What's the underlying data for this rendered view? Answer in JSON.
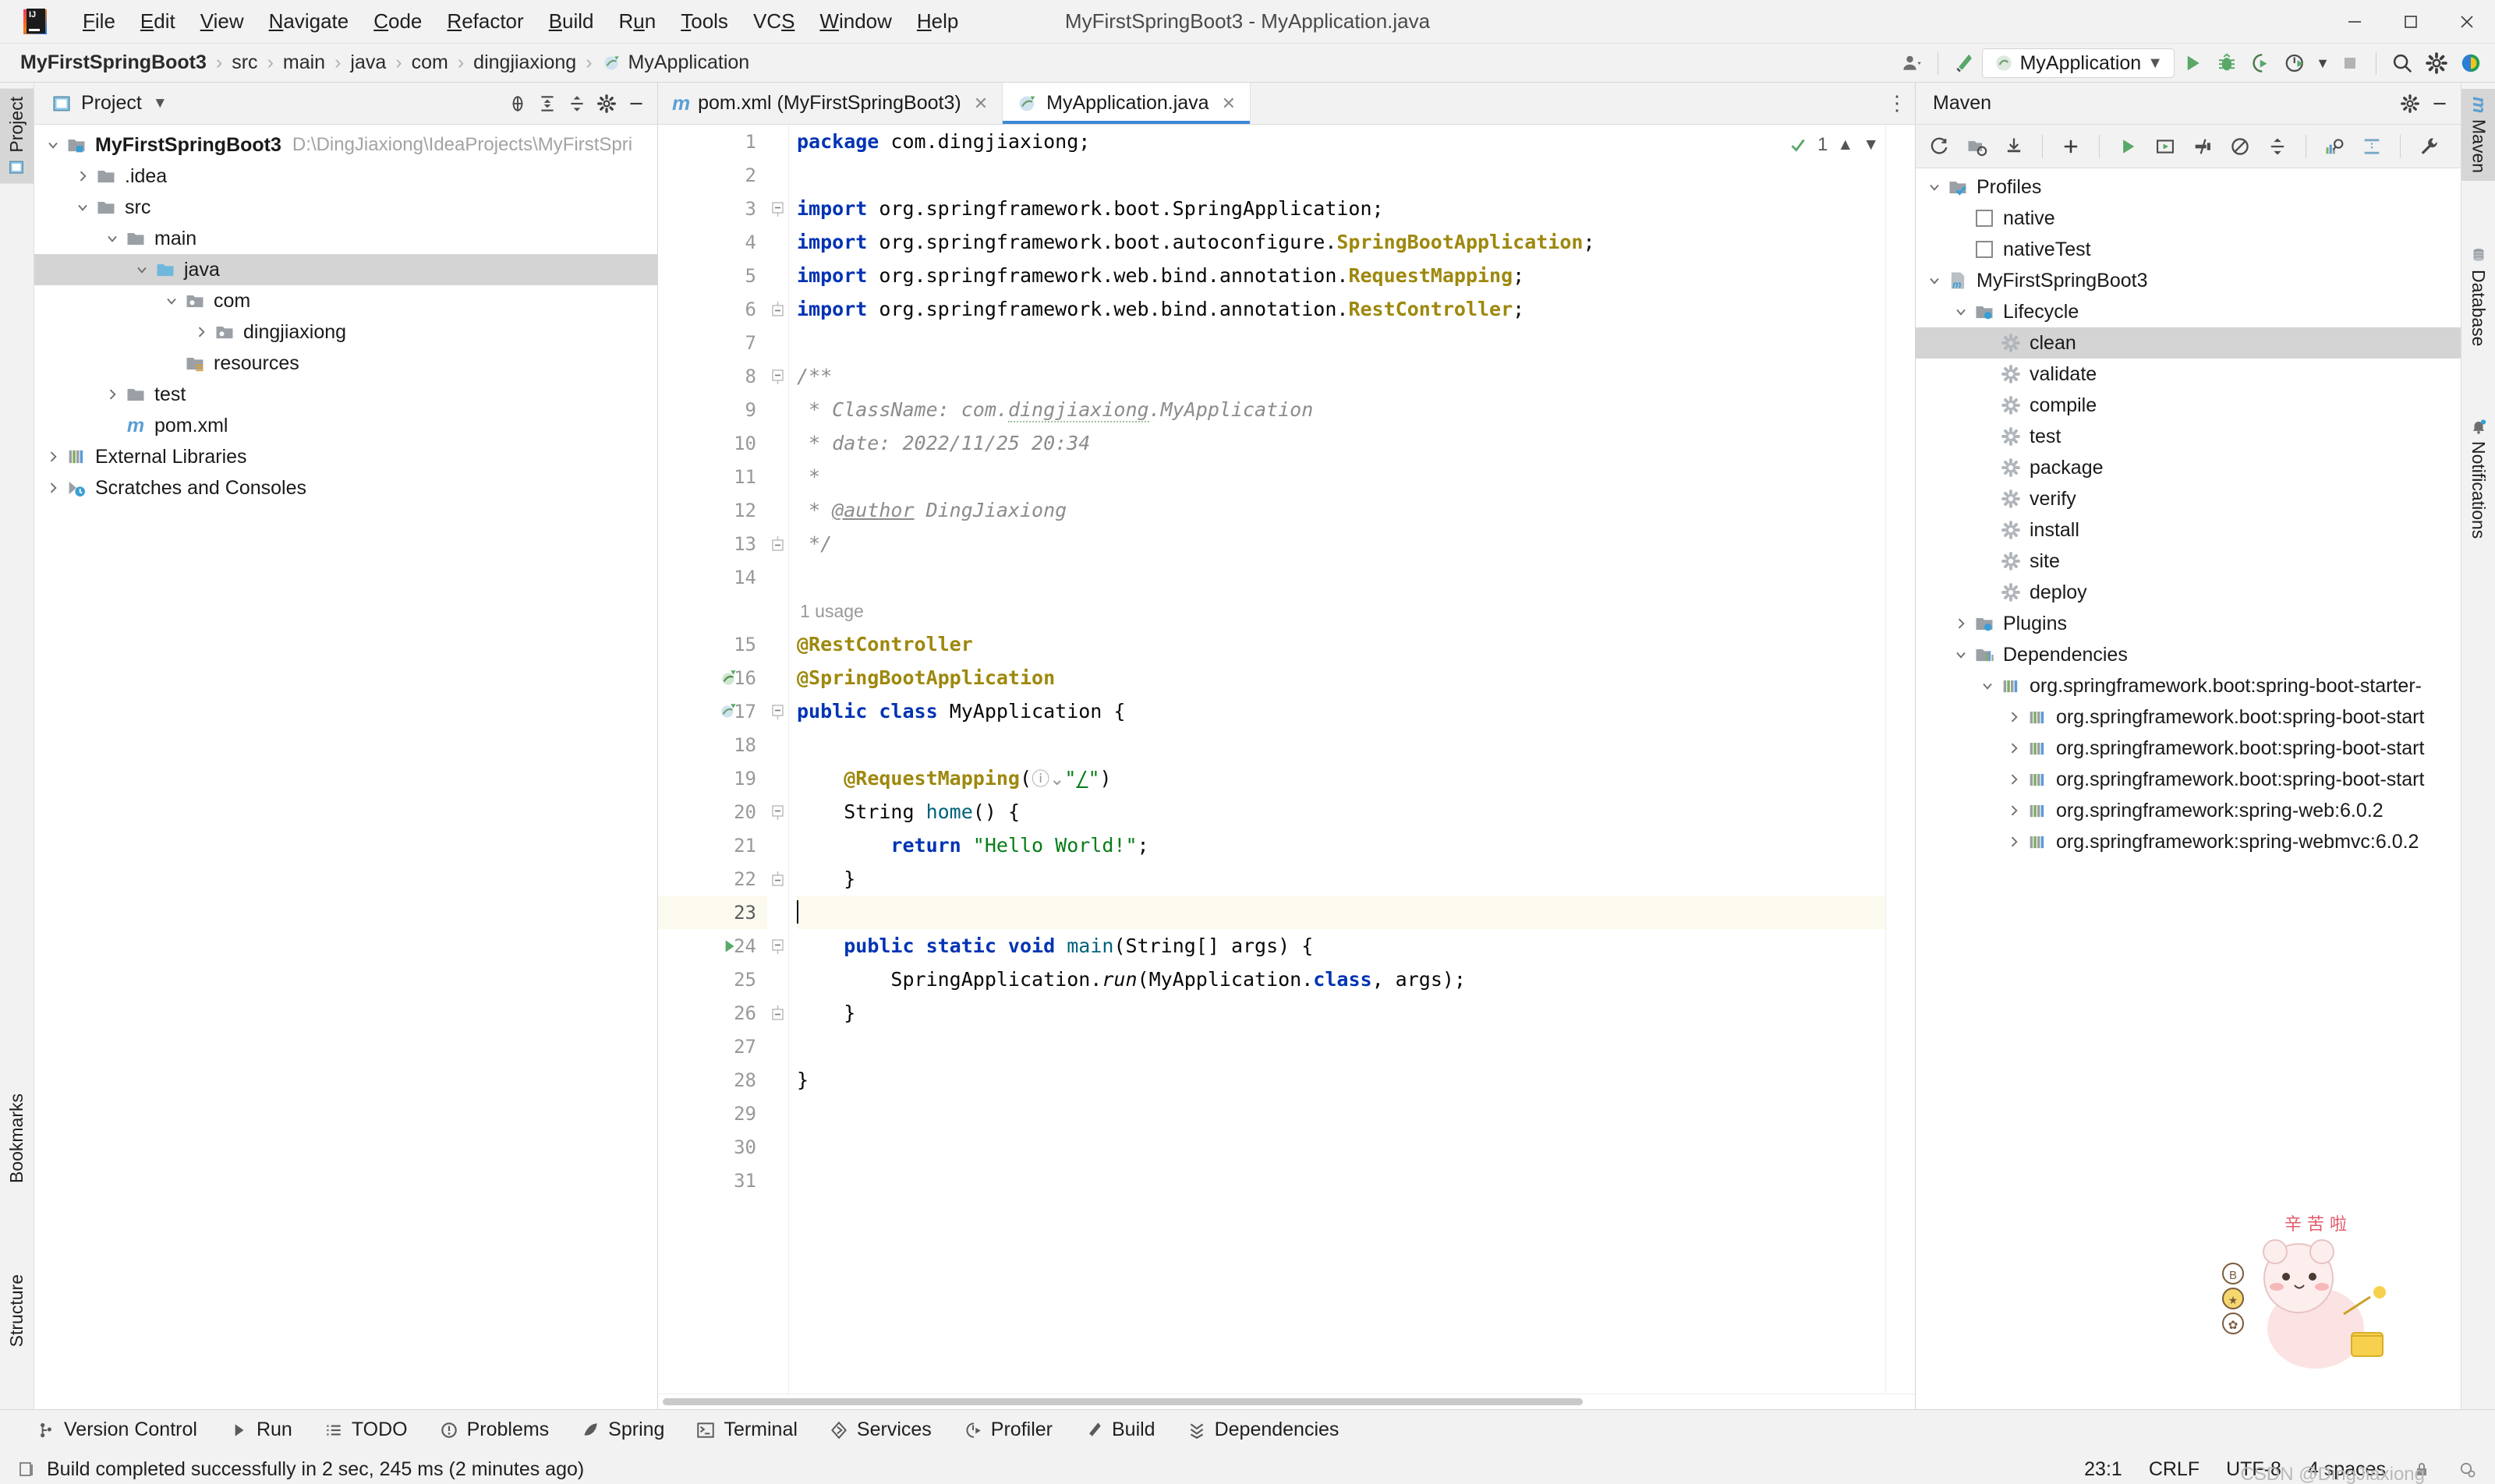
{
  "window": {
    "title": "MyFirstSpringBoot3 - MyApplication.java",
    "minimize_label": "—",
    "maximize_label": "❐",
    "close_label": "✕"
  },
  "menubar": {
    "items": [
      {
        "label": "File",
        "mnemonic": "F"
      },
      {
        "label": "Edit",
        "mnemonic": "E"
      },
      {
        "label": "View",
        "mnemonic": "V"
      },
      {
        "label": "Navigate",
        "mnemonic": "N"
      },
      {
        "label": "Code",
        "mnemonic": "C"
      },
      {
        "label": "Refactor",
        "mnemonic": "R"
      },
      {
        "label": "Build",
        "mnemonic": "B"
      },
      {
        "label": "Run",
        "mnemonic": "u"
      },
      {
        "label": "Tools",
        "mnemonic": "T"
      },
      {
        "label": "VCS",
        "mnemonic": "S"
      },
      {
        "label": "Window",
        "mnemonic": "W"
      },
      {
        "label": "Help",
        "mnemonic": "H"
      }
    ]
  },
  "navbar": {
    "crumbs": [
      "MyFirstSpringBoot3",
      "src",
      "main",
      "java",
      "com",
      "dingjiaxiong",
      "MyApplication"
    ],
    "separator": "›",
    "run_config": "MyApplication",
    "icons": [
      "profile-icon",
      "build-hammer-icon",
      "run-icon",
      "debug-icon",
      "run-coverage-icon",
      "profiler-icon",
      "stop-icon",
      "search-icon",
      "settings-icon",
      "ide-assistant-icon"
    ]
  },
  "left_toolbar": {
    "tabs": [
      {
        "label": "Project",
        "selected": true
      },
      {
        "label": "Bookmarks",
        "selected": false
      },
      {
        "label": "Structure",
        "selected": false
      }
    ]
  },
  "right_toolbar": {
    "tabs": [
      {
        "label": "Maven",
        "selected": true
      },
      {
        "label": "Database",
        "selected": false
      },
      {
        "label": "Notifications",
        "selected": false
      }
    ]
  },
  "project_panel": {
    "title": "Project",
    "toolbar_icons": [
      "locate-icon",
      "expand-all-icon",
      "collapse-all-icon",
      "settings-icon",
      "hide-icon"
    ],
    "tree": [
      {
        "depth": 0,
        "arrow": "down",
        "icon": "module-icon",
        "label": "MyFirstSpringBoot3",
        "bold": true,
        "sub": "D:\\DingJiaxiong\\IdeaProjects\\MyFirstSpri",
        "selected": false
      },
      {
        "depth": 1,
        "arrow": "right",
        "icon": "folder-icon",
        "label": ".idea",
        "bold": false,
        "sub": "",
        "selected": false
      },
      {
        "depth": 1,
        "arrow": "down",
        "icon": "folder-icon",
        "label": "src",
        "bold": false,
        "sub": "",
        "selected": false
      },
      {
        "depth": 2,
        "arrow": "down",
        "icon": "folder-icon",
        "label": "main",
        "bold": false,
        "sub": "",
        "selected": false
      },
      {
        "depth": 3,
        "arrow": "down",
        "icon": "source-folder-icon",
        "label": "java",
        "bold": false,
        "sub": "",
        "selected": true
      },
      {
        "depth": 4,
        "arrow": "down",
        "icon": "package-icon",
        "label": "com",
        "bold": false,
        "sub": "",
        "selected": false
      },
      {
        "depth": 5,
        "arrow": "right",
        "icon": "package-icon",
        "label": "dingjiaxiong",
        "bold": false,
        "sub": "",
        "selected": false
      },
      {
        "depth": 4,
        "arrow": "none",
        "icon": "resources-folder-icon",
        "label": "resources",
        "bold": false,
        "sub": "",
        "selected": false
      },
      {
        "depth": 2,
        "arrow": "right",
        "icon": "folder-icon",
        "label": "test",
        "bold": false,
        "sub": "",
        "selected": false
      },
      {
        "depth": 2,
        "arrow": "none",
        "icon": "maven-file-icon",
        "label": "pom.xml",
        "bold": false,
        "sub": "",
        "selected": false
      },
      {
        "depth": 0,
        "arrow": "right",
        "icon": "library-icon",
        "label": "External Libraries",
        "bold": false,
        "sub": "",
        "selected": false
      },
      {
        "depth": 0,
        "arrow": "right",
        "icon": "scratches-icon",
        "label": "Scratches and Consoles",
        "bold": false,
        "sub": "",
        "selected": false
      }
    ]
  },
  "editor": {
    "tabs": [
      {
        "label": "pom.xml (MyFirstSpringBoot3)",
        "icon": "maven-file-icon",
        "active": false,
        "closable": true
      },
      {
        "label": "MyApplication.java",
        "icon": "spring-class-icon",
        "active": true,
        "closable": true
      }
    ],
    "inspection_count": "1",
    "inspection_icons": [
      "inspection-ok-icon",
      "prev-problem-icon",
      "next-problem-icon"
    ],
    "tab_overflow_icon": "more-vertical-icon",
    "total_lines": 31,
    "current_line": 23,
    "lines": [
      {
        "n": 1,
        "html": "<span class=\"kw\">package</span> <span class=\"plain\">com.dingjiaxiong;</span>"
      },
      {
        "n": 2,
        "html": ""
      },
      {
        "n": 3,
        "html": "<span class=\"kw\">import</span> <span class=\"plain\">org.springframework.boot.SpringApplication;</span>"
      },
      {
        "n": 4,
        "html": "<span class=\"kw\">import</span> <span class=\"plain\">org.springframework.boot.autoconfigure.</span><span class=\"ann\">SpringBootApplication</span><span class=\"plain\">;</span>"
      },
      {
        "n": 5,
        "html": "<span class=\"kw\">import</span> <span class=\"plain\">org.springframework.web.bind.annotation.</span><span class=\"ann\">RequestMapping</span><span class=\"plain\">;</span>"
      },
      {
        "n": 6,
        "html": "<span class=\"kw\">import</span> <span class=\"plain\">org.springframework.web.bind.annotation.</span><span class=\"ann\">RestController</span><span class=\"plain\">;</span>"
      },
      {
        "n": 7,
        "html": ""
      },
      {
        "n": 8,
        "html": "<span class=\"cmt\">/**</span>"
      },
      {
        "n": 9,
        "html": "<span class=\"cmt\"> * ClassName: com.<span class=\"squig\">dingjiaxiong</span>.MyApplication</span>"
      },
      {
        "n": 10,
        "html": "<span class=\"cmt\"> * date: 2022/11/25 20:34</span>"
      },
      {
        "n": 11,
        "html": "<span class=\"cmt\"> *</span>"
      },
      {
        "n": 12,
        "html": "<span class=\"cmt\"> * <span class=\"ulink\">@author</span> DingJiaxiong</span>"
      },
      {
        "n": 13,
        "html": "<span class=\"cmt\"> */</span>"
      },
      {
        "n": 14,
        "html": ""
      },
      {
        "n": 15,
        "html": "<span class=\"ann\">@RestController</span>",
        "above": "1 usage"
      },
      {
        "n": 16,
        "html": "<span class=\"ann\">@SpringBootApplication</span>"
      },
      {
        "n": 17,
        "html": "<span class=\"kw\">public class</span> <span class=\"plain\">MyApplication {</span>"
      },
      {
        "n": 18,
        "html": ""
      },
      {
        "n": 19,
        "html": "    <span class=\"ann\">@RequestMapping</span><span class=\"plain\">(</span><span class=\"hint\">ⓘ⌄</span><span class=\"str\">\"<span class=\"ulink\">/</span>\"</span><span class=\"plain\">)</span>"
      },
      {
        "n": 20,
        "html": "    <span class=\"plain\">String </span><span class=\"fn\">home</span><span class=\"plain\">() {</span>"
      },
      {
        "n": 21,
        "html": "        <span class=\"kw\">return</span> <span class=\"str\">\"Hello World!\"</span><span class=\"plain\">;</span>"
      },
      {
        "n": 22,
        "html": "    <span class=\"plain\">}</span>"
      },
      {
        "n": 23,
        "html": "<span class=\"caret\"></span>"
      },
      {
        "n": 24,
        "html": "    <span class=\"kw\">public static void</span> <span class=\"fn\">main</span><span class=\"plain\">(String[] args) {</span>"
      },
      {
        "n": 25,
        "html": "        <span class=\"plain\">SpringApplication.</span><span class=\"ital plain\">run</span><span class=\"plain\">(MyApplication.</span><span class=\"kw\">class</span><span class=\"plain\">, args);</span>"
      },
      {
        "n": 26,
        "html": "    <span class=\"plain\">}</span>"
      },
      {
        "n": 27,
        "html": ""
      },
      {
        "n": 28,
        "html": "<span class=\"plain\">}</span>"
      },
      {
        "n": 29,
        "html": ""
      },
      {
        "n": 30,
        "html": ""
      },
      {
        "n": 31,
        "html": ""
      }
    ]
  },
  "maven_panel": {
    "title": "Maven",
    "header_icons": [
      "settings-icon",
      "hide-icon"
    ],
    "toolbar_icons": [
      "reload-icon",
      "add-maven-project-icon",
      "download-sources-icon",
      "add-icon",
      "run-icon",
      "execute-goal-icon",
      "toggle-skip-tests-icon",
      "toggle-offline-icon",
      "collapse-all-icon",
      "show-dependencies-icon",
      "expand-icon",
      "settings-wrench-icon"
    ],
    "tree": [
      {
        "depth": 0,
        "arrow": "down",
        "icon": "profiles-icon",
        "label": "Profiles",
        "selected": false
      },
      {
        "depth": 1,
        "arrow": "none",
        "icon": "checkbox",
        "label": "native",
        "selected": false
      },
      {
        "depth": 1,
        "arrow": "none",
        "icon": "checkbox",
        "label": "nativeTest",
        "selected": false
      },
      {
        "depth": 0,
        "arrow": "down",
        "icon": "maven-project-icon",
        "label": "MyFirstSpringBoot3",
        "selected": false
      },
      {
        "depth": 1,
        "arrow": "down",
        "icon": "lifecycle-folder-icon",
        "label": "Lifecycle",
        "selected": false
      },
      {
        "depth": 2,
        "arrow": "none",
        "icon": "goal-icon",
        "label": "clean",
        "selected": true
      },
      {
        "depth": 2,
        "arrow": "none",
        "icon": "goal-icon",
        "label": "validate",
        "selected": false
      },
      {
        "depth": 2,
        "arrow": "none",
        "icon": "goal-icon",
        "label": "compile",
        "selected": false
      },
      {
        "depth": 2,
        "arrow": "none",
        "icon": "goal-icon",
        "label": "test",
        "selected": false
      },
      {
        "depth": 2,
        "arrow": "none",
        "icon": "goal-icon",
        "label": "package",
        "selected": false
      },
      {
        "depth": 2,
        "arrow": "none",
        "icon": "goal-icon",
        "label": "verify",
        "selected": false
      },
      {
        "depth": 2,
        "arrow": "none",
        "icon": "goal-icon",
        "label": "install",
        "selected": false
      },
      {
        "depth": 2,
        "arrow": "none",
        "icon": "goal-icon",
        "label": "site",
        "selected": false
      },
      {
        "depth": 2,
        "arrow": "none",
        "icon": "goal-icon",
        "label": "deploy",
        "selected": false
      },
      {
        "depth": 1,
        "arrow": "right",
        "icon": "plugins-folder-icon",
        "label": "Plugins",
        "selected": false
      },
      {
        "depth": 1,
        "arrow": "down",
        "icon": "dependencies-icon",
        "label": "Dependencies",
        "selected": false
      },
      {
        "depth": 2,
        "arrow": "down",
        "icon": "dependency-icon",
        "label": "org.springframework.boot:spring-boot-starter-",
        "selected": false
      },
      {
        "depth": 3,
        "arrow": "right",
        "icon": "dependency-icon",
        "label": "org.springframework.boot:spring-boot-start",
        "selected": false
      },
      {
        "depth": 3,
        "arrow": "right",
        "icon": "dependency-icon",
        "label": "org.springframework.boot:spring-boot-start",
        "selected": false
      },
      {
        "depth": 3,
        "arrow": "right",
        "icon": "dependency-icon",
        "label": "org.springframework.boot:spring-boot-start",
        "selected": false
      },
      {
        "depth": 3,
        "arrow": "right",
        "icon": "dependency-icon",
        "label": "org.springframework:spring-web:6.0.2",
        "selected": false
      },
      {
        "depth": 3,
        "arrow": "right",
        "icon": "dependency-icon",
        "label": "org.springframework:spring-webmvc:6.0.2",
        "selected": false
      }
    ]
  },
  "bottom_bar": {
    "items": [
      {
        "label": "Version Control",
        "icon": "branch-icon"
      },
      {
        "label": "Run",
        "icon": "run-icon"
      },
      {
        "label": "TODO",
        "icon": "todo-icon"
      },
      {
        "label": "Problems",
        "icon": "problems-icon"
      },
      {
        "label": "Spring",
        "icon": "spring-leaf-icon"
      },
      {
        "label": "Terminal",
        "icon": "terminal-icon"
      },
      {
        "label": "Services",
        "icon": "services-icon"
      },
      {
        "label": "Profiler",
        "icon": "profiler-icon"
      },
      {
        "label": "Build",
        "icon": "build-hammer-icon"
      },
      {
        "label": "Dependencies",
        "icon": "dependencies-icon"
      }
    ]
  },
  "status_bar": {
    "message": "Build completed successfully in 2 sec, 245 ms (2 minutes ago)",
    "message_icon": "build-status-icon",
    "caret_position": "23:1",
    "line_separator": "CRLF",
    "encoding": "UTF-8",
    "indent": "4 spaces",
    "lock_icon": "lock-icon",
    "inspection_icon": "inspection-settings-icon",
    "watermark": "CSDN @DingJiaxiong"
  },
  "sticker": {
    "text_top": "辛 苦 啦",
    "alt": "cute-bear-sticker"
  },
  "colors": {
    "keyword": "#0033b3",
    "annotation": "#9e880d",
    "string": "#067d17",
    "comment": "#8c8c8c",
    "method": "#00627a",
    "accent": "#3c88d8",
    "selection": "#d4d4d4",
    "current_line": "#fcfaef"
  }
}
